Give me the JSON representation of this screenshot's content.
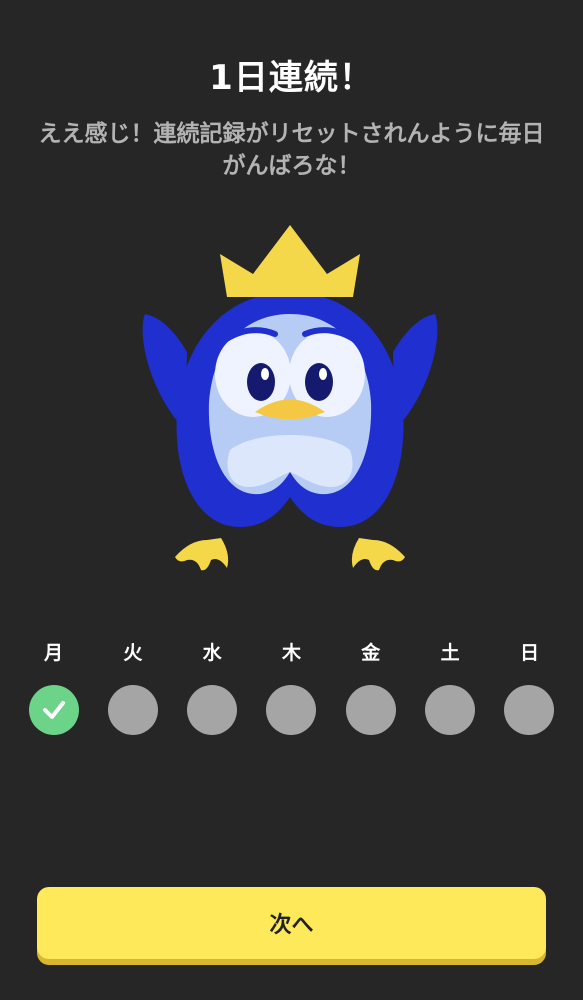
{
  "header": {
    "title": "1日連続！",
    "subtitle": "ええ感じ！連続記録がリセットされんように毎日がんばろな！"
  },
  "mascot": {
    "icon": "penguin-king-icon",
    "body_color": "#1f2fd0",
    "face_color": "#b7ccf5",
    "crown_color": "#f5d84a"
  },
  "week": {
    "days": [
      {
        "label": "月",
        "completed": true
      },
      {
        "label": "火",
        "completed": false
      },
      {
        "label": "水",
        "completed": false
      },
      {
        "label": "木",
        "completed": false
      },
      {
        "label": "金",
        "completed": false
      },
      {
        "label": "土",
        "completed": false
      },
      {
        "label": "日",
        "completed": false
      }
    ],
    "completed_color": "#6bd488",
    "pending_color": "#a5a5a5"
  },
  "actions": {
    "next_label": "次へ",
    "accent_color": "#fde95a"
  }
}
